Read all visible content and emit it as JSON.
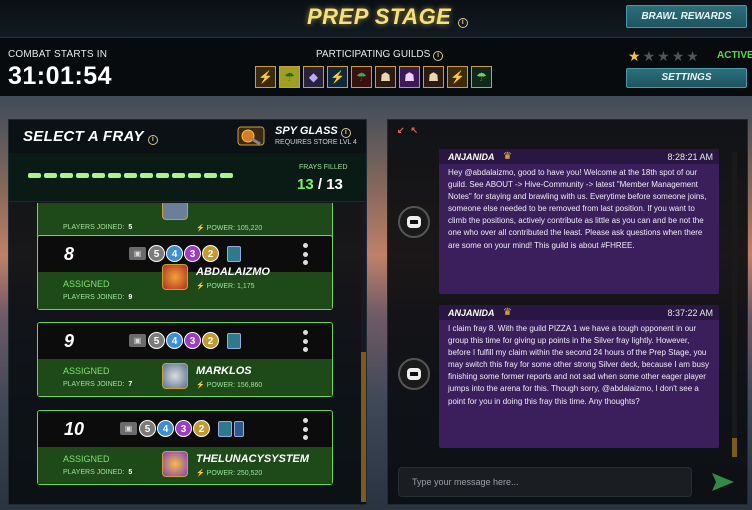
{
  "header": {
    "title": "PREP STAGE",
    "brawl_rewards": "BRAWL REWARDS",
    "settings": "SETTINGS",
    "combat_label": "COMBAT STARTS IN",
    "timer": "31:01:54",
    "guilds_label": "PARTICIPATING GUILDS",
    "status": "ACTIVE",
    "stars_filled": 1,
    "stars_total": 5,
    "colors": {
      "title": "#f7e27a",
      "active": "#53d94b",
      "teal_button": "#2b6f7a"
    }
  },
  "fray_panel": {
    "title": "SELECT A FRAY",
    "spy_glass": "SPY GLASS",
    "spy_sub": "REQUIRES STORE LVL 4",
    "frays_filled_label": "FRAYS FILLED",
    "filled": "13",
    "total": "13",
    "filled_count": 13,
    "cards": [
      {
        "number": "",
        "status": "",
        "players_label": "PLAYERS JOINED:",
        "players": "5",
        "name": "",
        "power_label": "POWER:",
        "power": "105,220",
        "partial": true
      },
      {
        "number": "8",
        "status": "ASSIGNED",
        "players_label": "PLAYERS JOINED:",
        "players": "9",
        "name": "ABDALAIZMO",
        "power_label": "POWER:",
        "power": "1,175",
        "pills": [
          "5",
          "4",
          "3",
          "2"
        ]
      },
      {
        "number": "9",
        "status": "ASSIGNED",
        "players_label": "PLAYERS JOINED:",
        "players": "7",
        "name": "MARKLOS",
        "power_label": "POWER:",
        "power": "156,860",
        "pills": [
          "5",
          "4",
          "3",
          "2"
        ]
      },
      {
        "number": "10",
        "status": "ASSIGNED",
        "players_label": "PLAYERS JOINED:",
        "players": "5",
        "name": "THELUNACYSYSTEM",
        "power_label": "POWER:",
        "power": "250,520",
        "pills": [
          "5",
          "4",
          "3",
          "2"
        ]
      }
    ]
  },
  "chat": {
    "messages": [
      {
        "author": "ANJANIDA",
        "time": "8:28:21 AM",
        "text": "Hey @abdalaizmo, good to have you! Welcome at the 18th spot of our guild. See ABOUT -> Hive-Community -> latest \"Member Management Notes\" for staying and brawling with us. Everytime before someone joins, someone else needed to be removed from last position. If you want to climb the positions, actively contribute as little as you can and be not the one who over all contributed the least. Please ask questions when there are some on your mind! This guild is about #FHREE."
      },
      {
        "author": "ANJANIDA",
        "time": "8:37:22 AM",
        "text": "I claim fray 8. With the guild PIZZA 1 we have a tough opponent in our group this time for giving up points in the Silver fray lightly. However, before I fulfill my claim within the second 24 hours of the Prep Stage, you may switch this fray for some other strong Silver deck, because I am busy finishing some former reports and not sad when some other eager player jumps into the arena for this. Though sorry, @abdalaizmo, I don't see a point for you in doing this fray this time. Any thoughts?"
      }
    ],
    "placeholder": "Type your message here..."
  }
}
